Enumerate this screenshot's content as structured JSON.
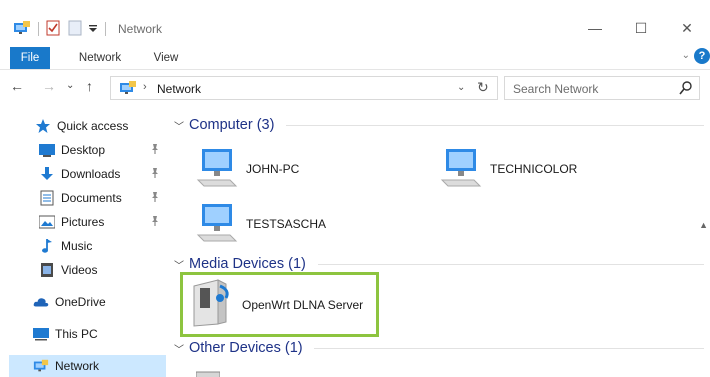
{
  "window": {
    "title": "Network",
    "controls": {
      "minimize": "—",
      "maximize": "☐",
      "close": "✕"
    }
  },
  "ribbon": {
    "tabs": [
      "File",
      "Network",
      "View"
    ],
    "expand_glyph": "⌄",
    "help_glyph": "?"
  },
  "address": {
    "back": "←",
    "forward": "→",
    "recent": "⌄",
    "up": "↑",
    "separator": "›",
    "path": "Network",
    "dropdown": "⌄",
    "refresh": "↻"
  },
  "search": {
    "placeholder": "Search Network"
  },
  "navpane": {
    "items": [
      {
        "label": "Quick access",
        "icon": "star-icon"
      },
      {
        "label": "Desktop",
        "icon": "desktop-icon",
        "pinned": true
      },
      {
        "label": "Downloads",
        "icon": "download-icon",
        "pinned": true
      },
      {
        "label": "Documents",
        "icon": "documents-icon",
        "pinned": true
      },
      {
        "label": "Pictures",
        "icon": "pictures-icon",
        "pinned": true
      },
      {
        "label": "Music",
        "icon": "music-icon"
      },
      {
        "label": "Videos",
        "icon": "videos-icon"
      },
      {
        "label": "OneDrive",
        "icon": "cloud-icon"
      },
      {
        "label": "This PC",
        "icon": "computer-icon"
      },
      {
        "label": "Network",
        "icon": "network-icon",
        "selected": true
      }
    ],
    "pin_glyph": "📌"
  },
  "content": {
    "groups": [
      {
        "header": "Computer (3)",
        "items": [
          "JOHN-PC",
          "TECHNICOLOR",
          "TESTSASCHA"
        ]
      },
      {
        "header": "Media Devices (1)",
        "items": [
          "OpenWrt DLNA Server"
        ]
      },
      {
        "header": "Other Devices (1)",
        "items": []
      }
    ]
  },
  "colors": {
    "accent": "#1979ca",
    "group_header": "#1e3287",
    "highlight_border": "#8dc43f",
    "selected_bg": "#cce8ff"
  }
}
